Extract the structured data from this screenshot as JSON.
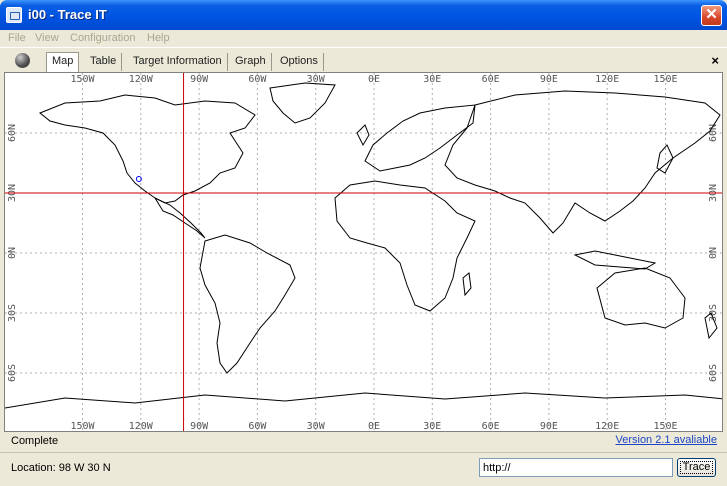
{
  "window": {
    "title": "i00 - Trace IT",
    "icon": "app-icon",
    "close_label": "✕"
  },
  "menu": [
    "File",
    "View",
    "Configuration",
    "Help"
  ],
  "tabs": [
    "Map",
    "Table",
    "Target Information",
    "Graph",
    "Options"
  ],
  "active_tab": "Map",
  "tab_close_label": "×",
  "map": {
    "lon_labels": [
      "150W",
      "120W",
      "90W",
      "60W",
      "30W",
      "0E",
      "30E",
      "60E",
      "90E",
      "120E",
      "150E"
    ],
    "lat_labels_left": [
      "60N",
      "30N",
      "0N",
      "30S",
      "60S"
    ],
    "lat_labels_right": [
      "60N",
      "30N",
      "0N",
      "30S",
      "60S"
    ],
    "crosshair": {
      "lon": -98,
      "lat": 30,
      "color": "#cc0000"
    },
    "marker": {
      "lon": -121,
      "lat": 37,
      "color": "#0000ff"
    },
    "grid_color": "#b0b0b0",
    "coast_color": "#000000"
  },
  "status": {
    "text": "Complete",
    "version_link": "Version 2.1 avaliable"
  },
  "bottom": {
    "location": "Location: 98 W 30 N",
    "url_value": "http://",
    "trace_label": "Trace"
  }
}
